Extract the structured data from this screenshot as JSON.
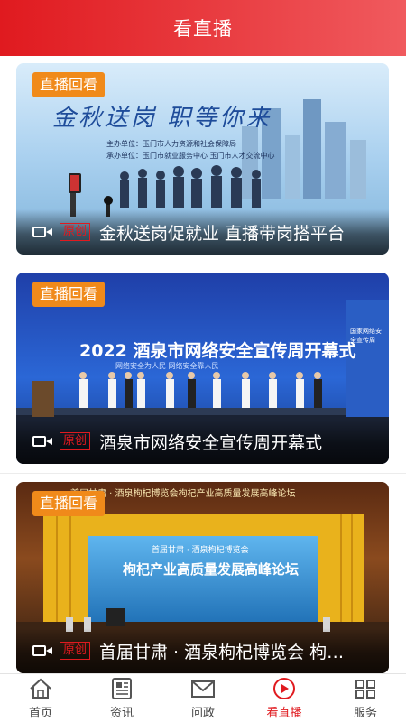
{
  "header": {
    "title": "看直播"
  },
  "cards": [
    {
      "badge": "直播回看",
      "original_tag": "原创",
      "title": "金秋送岗促就业 直播带岗搭平台",
      "scene_banner": "金秋送岗 职等你来",
      "scene_sub1": "主办单位：玉门市人力资源和社会保障局",
      "scene_sub2": "承办单位：玉门市就业服务中心 玉门市人才交流中心"
    },
    {
      "badge": "直播回看",
      "original_tag": "原创",
      "title": "酒泉市网络安全宣传周开幕式",
      "scene_banner": "2022 酒泉市网络安全宣传周开幕式",
      "scene_sub1": "网络安全为人民 网络安全靠人民",
      "scene_side": "国家网络安全宣传周"
    },
    {
      "badge": "直播回看",
      "original_tag": "原创",
      "title": "首届甘肃 · 酒泉枸杞博览会 枸…",
      "scene_top": "首届甘肃 · 酒泉枸杞博览会枸杞产业高质量发展高峰论坛",
      "scene_banner": "枸杞产业高质量发展高峰论坛",
      "scene_sub1": "首届甘肃 · 酒泉枸杞博览会"
    }
  ],
  "tabs": [
    {
      "label": "首页",
      "icon": "home-icon",
      "active": false
    },
    {
      "label": "资讯",
      "icon": "news-icon",
      "active": false
    },
    {
      "label": "问政",
      "icon": "mail-icon",
      "active": false
    },
    {
      "label": "看直播",
      "icon": "live-play-icon",
      "active": true
    },
    {
      "label": "服务",
      "icon": "service-icon",
      "active": false
    }
  ],
  "colors": {
    "brand_red": "#e01a1f",
    "badge_orange": "#f08a1a"
  }
}
